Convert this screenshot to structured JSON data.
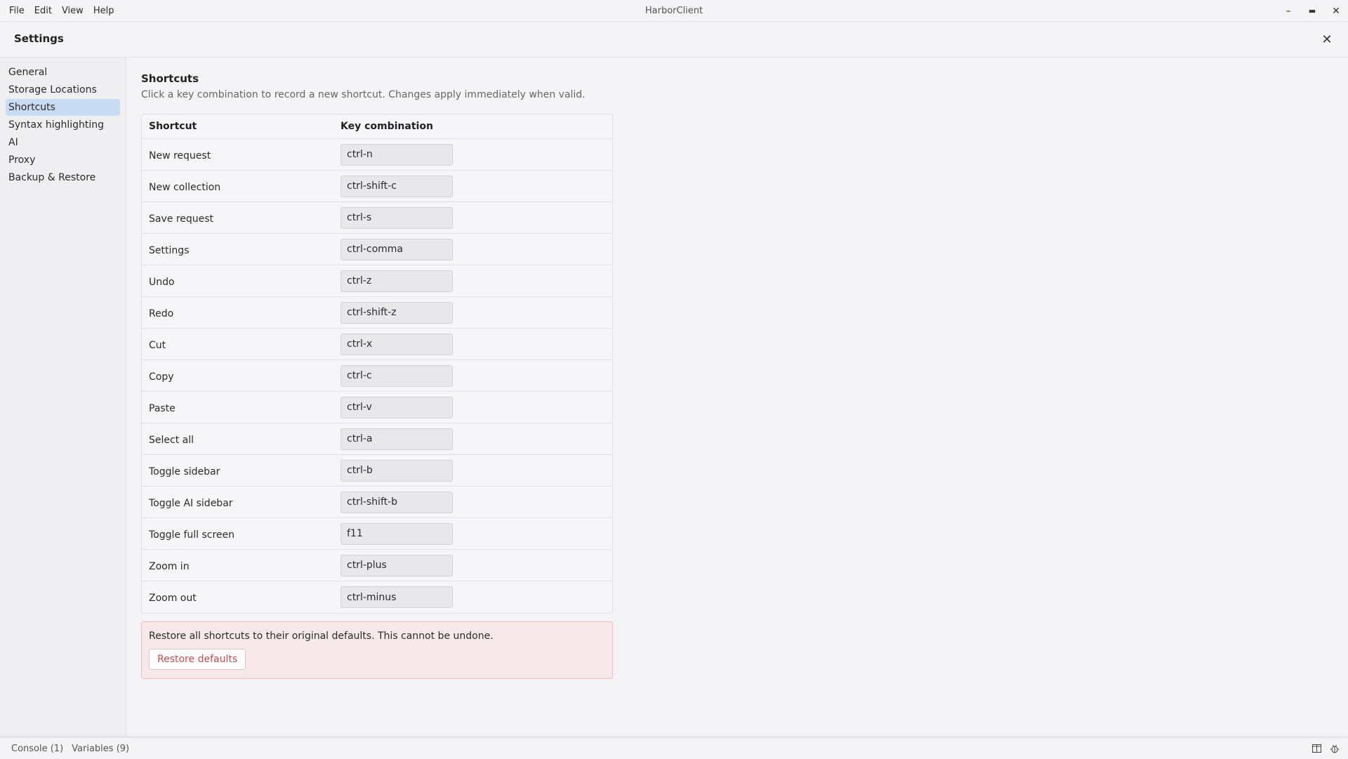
{
  "window": {
    "title": "HarborClient",
    "menu": [
      "File",
      "Edit",
      "View",
      "Help"
    ],
    "controls": {
      "minimize": "–",
      "maximize": "▬",
      "close": "✕"
    }
  },
  "settings": {
    "title": "Settings",
    "close_icon": "✕"
  },
  "sidebar": {
    "items": [
      {
        "label": "General",
        "active": false
      },
      {
        "label": "Storage Locations",
        "active": false
      },
      {
        "label": "Shortcuts",
        "active": true
      },
      {
        "label": "Syntax highlighting",
        "active": false
      },
      {
        "label": "AI",
        "active": false
      },
      {
        "label": "Proxy",
        "active": false
      },
      {
        "label": "Backup & Restore",
        "active": false
      }
    ]
  },
  "shortcuts": {
    "title": "Shortcuts",
    "description": "Click a key combination to record a new shortcut. Changes apply immediately when valid.",
    "columns": [
      "Shortcut",
      "Key combination"
    ],
    "rows": [
      {
        "name": "New request",
        "keys": "ctrl-n"
      },
      {
        "name": "New collection",
        "keys": "ctrl-shift-c"
      },
      {
        "name": "Save request",
        "keys": "ctrl-s"
      },
      {
        "name": "Settings",
        "keys": "ctrl-comma"
      },
      {
        "name": "Undo",
        "keys": "ctrl-z"
      },
      {
        "name": "Redo",
        "keys": "ctrl-shift-z"
      },
      {
        "name": "Cut",
        "keys": "ctrl-x"
      },
      {
        "name": "Copy",
        "keys": "ctrl-c"
      },
      {
        "name": "Paste",
        "keys": "ctrl-v"
      },
      {
        "name": "Select all",
        "keys": "ctrl-a"
      },
      {
        "name": "Toggle sidebar",
        "keys": "ctrl-b"
      },
      {
        "name": "Toggle AI sidebar",
        "keys": "ctrl-shift-b"
      },
      {
        "name": "Toggle full screen",
        "keys": "f11"
      },
      {
        "name": "Zoom in",
        "keys": "ctrl-plus"
      },
      {
        "name": "Zoom out",
        "keys": "ctrl-minus"
      }
    ],
    "restore": {
      "text": "Restore all shortcuts to their original defaults. This cannot be undone.",
      "button": "Restore defaults",
      "accent": "#d9474f"
    }
  },
  "statusbar": {
    "console": "Console (1)",
    "variables": "Variables (9)",
    "icons": [
      "layout-icon",
      "bug-icon"
    ]
  },
  "colors": {
    "active_nav": "#c9dbf3",
    "danger_bg": "#f7e8e9",
    "danger_text": "#d9474f"
  }
}
